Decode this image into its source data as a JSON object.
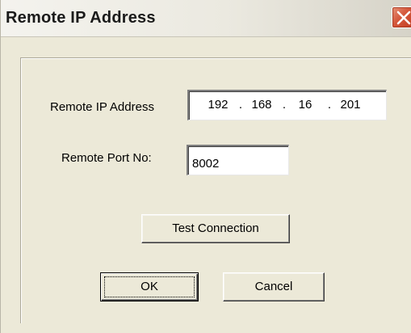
{
  "window": {
    "title": "Remote IP Address"
  },
  "form": {
    "ip_label": "Remote IP Address",
    "ip_octets": [
      "192",
      "168",
      "16",
      "201"
    ],
    "ip_separator": ".",
    "port_label": "Remote Port No:",
    "port_value": "8002"
  },
  "buttons": {
    "test_connection": "Test Connection",
    "ok": "OK",
    "cancel": "Cancel"
  },
  "icons": {
    "close": "close-icon"
  },
  "colors": {
    "dialog_background": "#ece9d8",
    "close_button": "#d4573b",
    "field_background": "#ffffff"
  }
}
